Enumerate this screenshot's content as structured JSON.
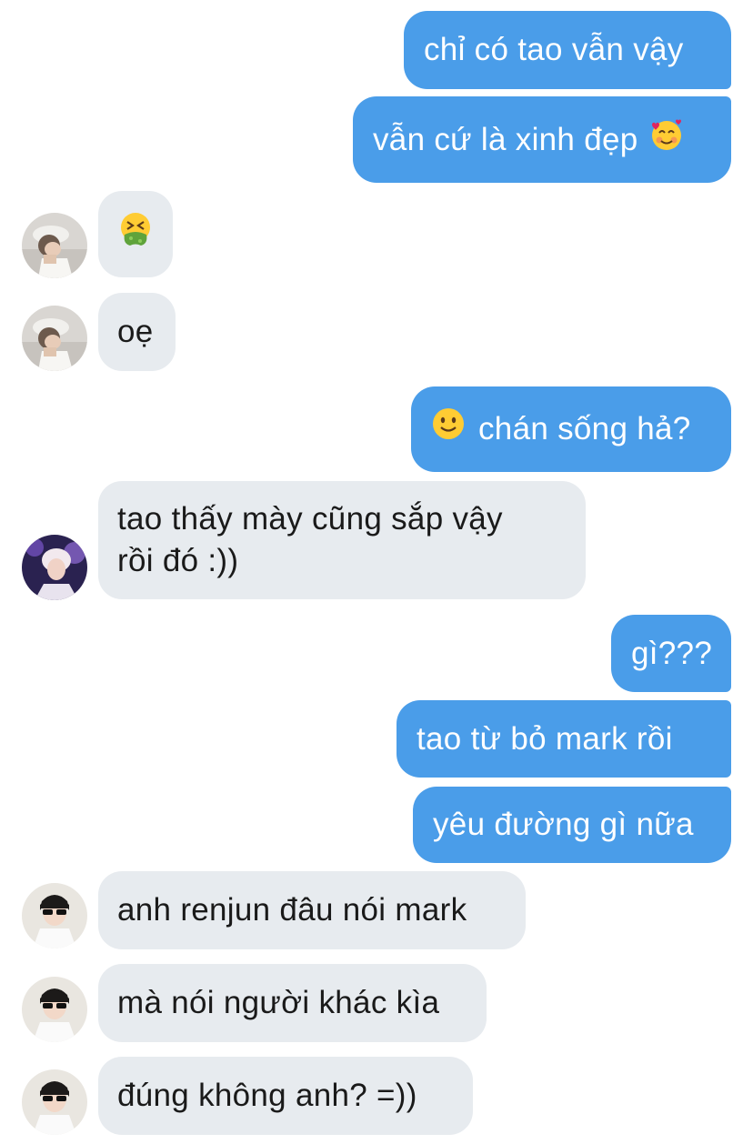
{
  "messages": [
    {
      "id": "m1",
      "dir": "out",
      "text": "chỉ có tao vẫn vậy"
    },
    {
      "id": "m2",
      "dir": "out",
      "text": "vẫn cứ là xinh đẹp",
      "emoji": "smiling-face-with-hearts-icon"
    },
    {
      "id": "m3",
      "dir": "in",
      "emoji": "nauseated-face-icon",
      "avatar": "avatar-white-cap"
    },
    {
      "id": "m4",
      "dir": "in",
      "text": "oẹ",
      "avatar": "avatar-white-cap"
    },
    {
      "id": "m5",
      "dir": "out",
      "text": "chán sống hả?",
      "emoji": "slightly-smiling-face-icon"
    },
    {
      "id": "m6",
      "dir": "in",
      "text_line1": "tao thấy mày cũng sắp vậy",
      "text_line2": "rồi đó :))",
      "avatar": "avatar-purple-light"
    },
    {
      "id": "m7",
      "dir": "out",
      "text": "gì???"
    },
    {
      "id": "m8",
      "dir": "out",
      "text": "tao từ bỏ mark rồi"
    },
    {
      "id": "m9",
      "dir": "out",
      "text": "yêu đường gì nữa"
    },
    {
      "id": "m10",
      "dir": "in",
      "text": "anh renjun đâu nói mark",
      "avatar": "avatar-sunglasses"
    },
    {
      "id": "m11",
      "dir": "in",
      "text": "mà nói người khác kìa",
      "avatar": "avatar-sunglasses"
    },
    {
      "id": "m12",
      "dir": "in",
      "text": "đúng không anh? =))",
      "avatar": "avatar-sunglasses"
    }
  ],
  "colors": {
    "outgoing_bubble": "#4a9de9",
    "incoming_bubble": "#e7ebef",
    "outgoing_text": "#ffffff",
    "incoming_text": "#1a1a1a"
  }
}
